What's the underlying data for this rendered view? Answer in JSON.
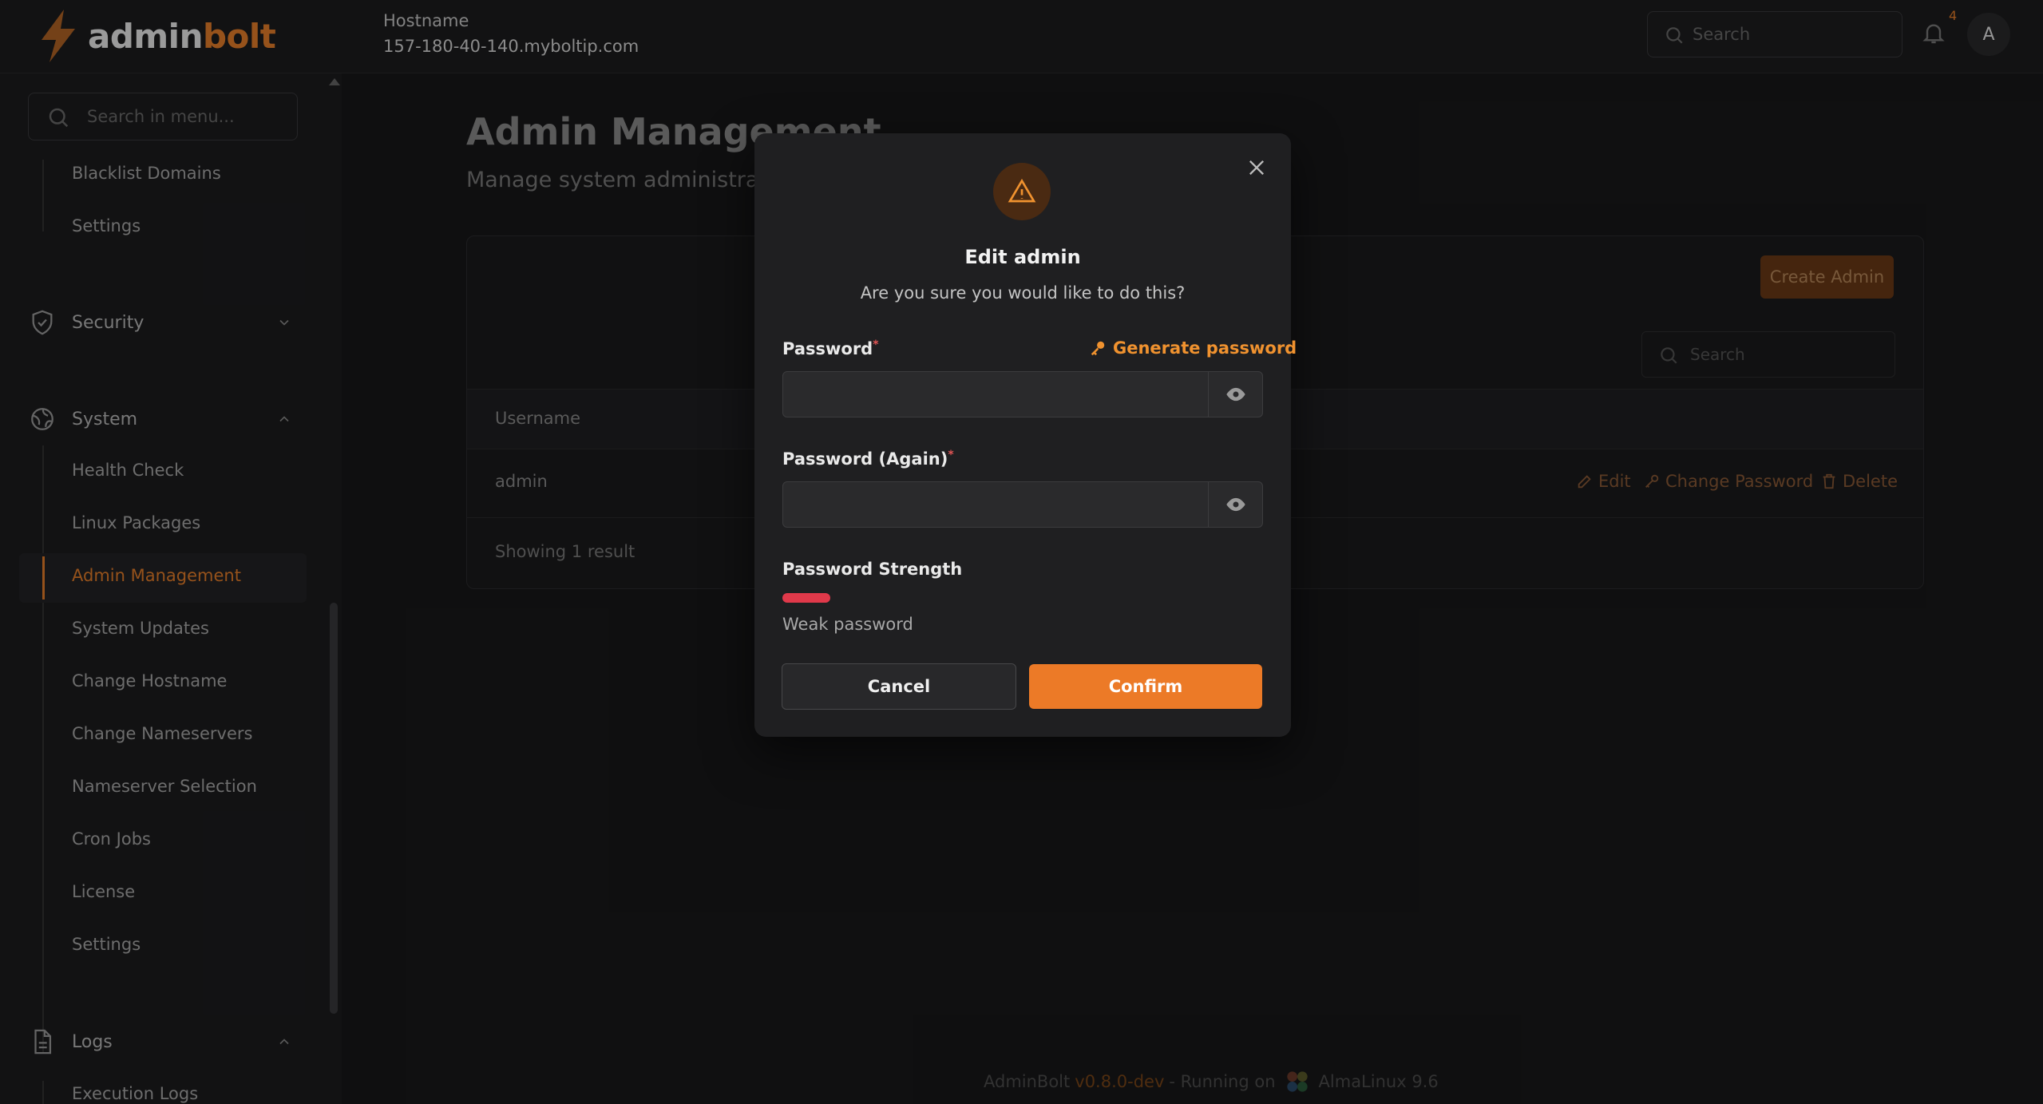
{
  "app": {
    "logo_part1": "admin",
    "logo_part2": "bolt",
    "accent_color": "#e67e2a"
  },
  "topbar": {
    "hostname_label": "Hostname",
    "hostname_value": "157-180-40-140.myboltip.com",
    "search_placeholder": "Search",
    "notification_count": "4",
    "avatar_initial": "A"
  },
  "sidebar": {
    "search_placeholder": "Search in menu...",
    "items_top": [
      "Blacklist Domains",
      "Settings"
    ],
    "security_label": "Security",
    "system_label": "System",
    "system_items": [
      "Health Check",
      "Linux Packages",
      "Admin Management",
      "System Updates",
      "Change Hostname",
      "Change Nameservers",
      "Nameserver Selection",
      "Cron Jobs",
      "License",
      "Settings"
    ],
    "active_item": "Admin Management",
    "logs_label": "Logs",
    "logs_items": [
      "Execution Logs"
    ]
  },
  "main": {
    "title": "Admin Management",
    "subtitle": "Manage system administrators",
    "create_button": "Create Admin",
    "search_placeholder": "Search",
    "table": {
      "columns": [
        "Username"
      ],
      "rows": [
        {
          "username": "admin"
        }
      ],
      "actions": [
        "Edit",
        "Change Password",
        "Delete"
      ]
    },
    "result_count": "Showing 1 result"
  },
  "footer": {
    "app_name": "AdminBolt",
    "version": "v0.8.0-dev",
    "running_on": "- Running on",
    "os": "AlmaLinux 9.6"
  },
  "modal": {
    "title": "Edit admin",
    "description": "Are you sure you would like to do this?",
    "password_label": "Password",
    "generate_password": "Generate password",
    "password_again_label": "Password (Again)",
    "strength_label": "Password Strength",
    "strength_value": "Weak password",
    "strength_level": 0.17,
    "strength_color": "#e0394a",
    "cancel": "Cancel",
    "confirm": "Confirm"
  }
}
